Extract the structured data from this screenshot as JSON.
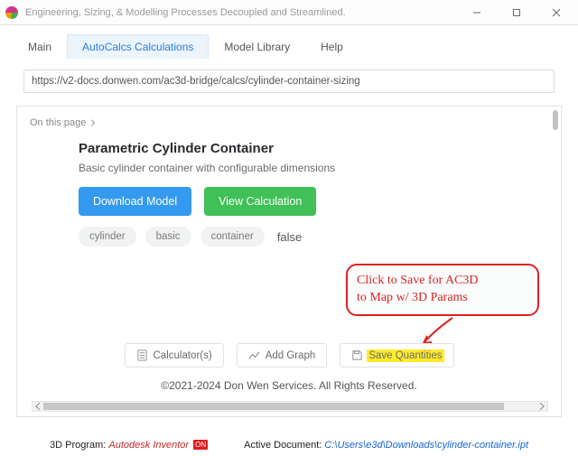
{
  "window": {
    "title": "Engineering, Sizing, & Modelling Processes Decoupled and Streamlined."
  },
  "tabs": {
    "main": "Main",
    "calcs": "AutoCalcs Calculations",
    "library": "Model Library",
    "help": "Help"
  },
  "url": "https://v2-docs.donwen.com/ac3d-bridge/calcs/cylinder-container-sizing",
  "onThisPage": "On this page",
  "card": {
    "title": "Parametric Cylinder Container",
    "desc": "Basic cylinder container with configurable dimensions",
    "btnDownload": "Download Model",
    "btnView": "View Calculation",
    "tags": [
      "cylinder",
      "basic",
      "container"
    ],
    "flag": "false"
  },
  "callout": {
    "line1": "Click to Save for AC3D",
    "line2": "to Map w/ 3D Params"
  },
  "actions": {
    "calculators": "Calculator(s)",
    "addgraph": "Add Graph",
    "save": "Save Quantities"
  },
  "copy": "©2021-2024 Don Wen Services. All Rights Reserved.",
  "status": {
    "progLabel": "3D Program: ",
    "progValue": "Autodesk Inventor",
    "progBadge": "ON",
    "docLabel": "Active Document: ",
    "docValue": "C:\\Users\\e3d\\Downloads\\cylinder-container.ipt"
  }
}
